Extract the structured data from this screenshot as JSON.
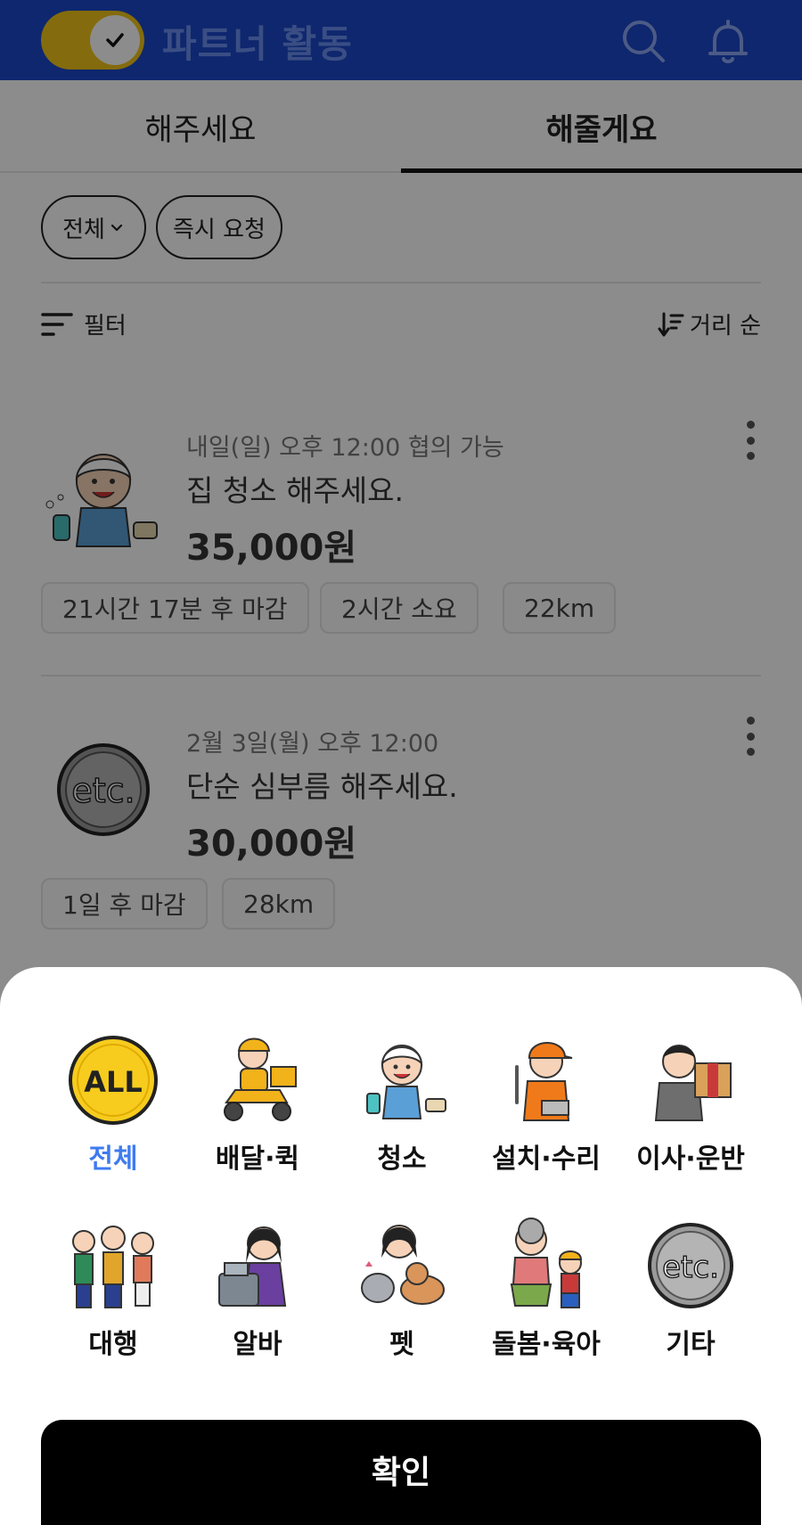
{
  "colors": {
    "header_bg": "#1b47c9",
    "toggle": "#f0c419",
    "active_category": "#3e7bf0",
    "confirm_bg": "#000000"
  },
  "header": {
    "title": "파트너 활동",
    "toggle_icon": "check-icon",
    "search_icon": "search-icon",
    "notification_icon": "bell-icon"
  },
  "tabs": [
    {
      "label": "해주세요",
      "active": false
    },
    {
      "label": "해줄게요",
      "active": true
    }
  ],
  "chips": {
    "all_label": "전체",
    "instant_label": "즉시 요청"
  },
  "toolbar": {
    "filter_label": "필터",
    "sort_label": "거리 순"
  },
  "cards": [
    {
      "icon": "cleaning-illustration",
      "meta": "내일(일) 오후 12:00 협의 가능",
      "title": "집 청소 해주세요.",
      "price": "35,000원",
      "tags": [
        "21시간 17분 후 마감",
        "2시간 소요",
        "22km"
      ]
    },
    {
      "icon": "etc-badge",
      "meta": "2월 3일(월) 오후 12:00",
      "title": "단순 심부름 해주세요.",
      "price": "30,000원",
      "tags": [
        "1일 후 마감",
        "28km"
      ]
    }
  ],
  "categories": [
    {
      "label": "전체",
      "icon": "all-badge-icon",
      "selected": true
    },
    {
      "label": "배달·퀵",
      "icon": "delivery-scooter-icon",
      "selected": false
    },
    {
      "label": "청소",
      "icon": "cleaning-icon",
      "selected": false
    },
    {
      "label": "설치·수리",
      "icon": "repair-worker-icon",
      "selected": false
    },
    {
      "label": "이사·운반",
      "icon": "moving-box-icon",
      "selected": false
    },
    {
      "label": "대행",
      "icon": "errand-people-icon",
      "selected": false
    },
    {
      "label": "알바",
      "icon": "part-time-cashier-icon",
      "selected": false
    },
    {
      "label": "펫",
      "icon": "pet-icon",
      "selected": false
    },
    {
      "label": "돌봄·육아",
      "icon": "care-childcare-icon",
      "selected": false
    },
    {
      "label": "기타",
      "icon": "etc-icon",
      "selected": false
    }
  ],
  "confirm": {
    "label": "확인"
  }
}
